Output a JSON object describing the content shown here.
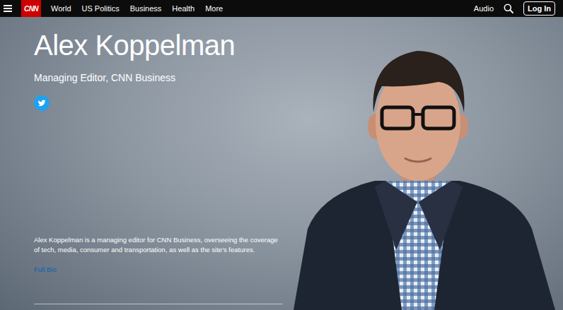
{
  "header": {
    "logo": "CNN",
    "nav": [
      "World",
      "US Politics",
      "Business",
      "Health",
      "More"
    ],
    "audio": "Audio",
    "login": "Log In"
  },
  "profile": {
    "name": "Alex Koppelman",
    "title": "Managing Editor, CNN Business",
    "bio": "Alex Koppelman is a managing editor for CNN Business, overseeing the coverage of tech, media, consumer and transportation, as well as the site's features.",
    "link": "Full Bio"
  }
}
